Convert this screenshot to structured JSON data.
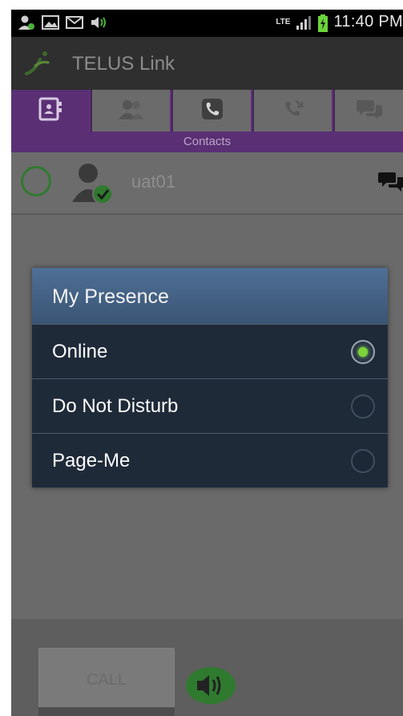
{
  "status_bar": {
    "time": "11:40 PM",
    "network": "LTE",
    "left_icons": [
      "contact-notify-icon",
      "picture-icon",
      "mail-icon",
      "volume-icon"
    ],
    "right_icons": [
      "lte-data-icon",
      "signal-icon",
      "battery-charging-icon"
    ]
  },
  "app": {
    "title": "TELUS Link"
  },
  "tabs": [
    {
      "name": "contacts",
      "icon": "contacts-book-icon",
      "active": true
    },
    {
      "name": "people",
      "icon": "people-icon",
      "active": false
    },
    {
      "name": "phone",
      "icon": "phone-icon",
      "active": false
    },
    {
      "name": "call-log",
      "icon": "call-log-icon",
      "active": false
    },
    {
      "name": "messages",
      "icon": "chat-bubbles-icon",
      "active": false
    }
  ],
  "active_tab_label": "Contacts",
  "contact": {
    "name": "uat01"
  },
  "dialog": {
    "title": "My Presence",
    "options": [
      {
        "label": "Online",
        "selected": true
      },
      {
        "label": "Do Not Disturb",
        "selected": false
      },
      {
        "label": "Page-Me",
        "selected": false
      }
    ]
  },
  "bottom": {
    "call_label": "CALL"
  },
  "colors": {
    "accent_purple": "#5a2f74",
    "dialog_header": "#4f6f96",
    "dialog_body": "#1f2a38",
    "online_green": "#7cd33a"
  }
}
